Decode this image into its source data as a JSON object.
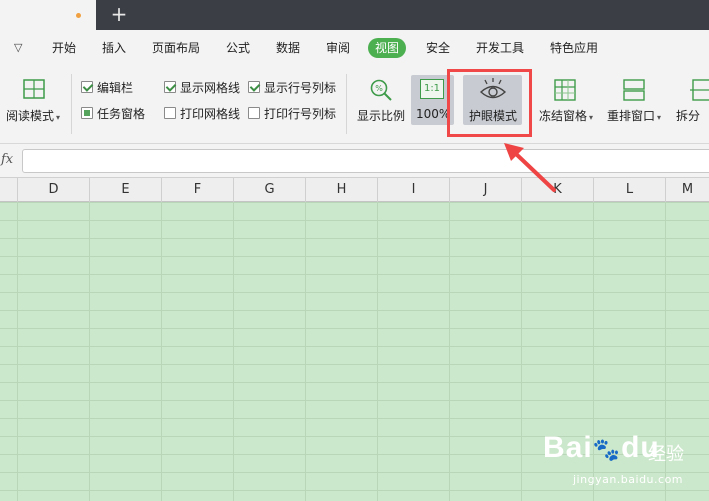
{
  "titlebar": {
    "new_tab_icon": "plus-icon"
  },
  "menu": {
    "dropdown_icon": "chevron-down-icon",
    "items": [
      "开始",
      "插入",
      "页面布局",
      "公式",
      "数据",
      "审阅",
      "视图",
      "安全",
      "开发工具",
      "特色应用"
    ],
    "active": "视图",
    "active_color": "#4caf50"
  },
  "ribbon": {
    "read_mode": "阅读模式",
    "edit_bar": "编辑栏",
    "task_pane": "任务窗格",
    "show_gridlines": "显示网格线",
    "print_gridlines": "打印网格线",
    "show_headings": "显示行号列标",
    "print_headings": "打印行号列标",
    "zoom": "显示比例",
    "zoom_100": "100%",
    "zoom_100_icon": "1:1",
    "eye_mode": "护眼模式",
    "freeze": "冻结窗格",
    "arrange": "重排窗口",
    "split": "拆分"
  },
  "formula": {
    "fx": "fx"
  },
  "columns": [
    "D",
    "E",
    "F",
    "G",
    "H",
    "I",
    "J",
    "K",
    "L",
    "M"
  ],
  "colors": {
    "highlight": "#f04848",
    "grid_bg": "#cce8cc"
  },
  "watermark": {
    "brand": "Bai",
    "brand_end": "du",
    "suffix": "经验",
    "url": "jingyan.baidu.com"
  }
}
